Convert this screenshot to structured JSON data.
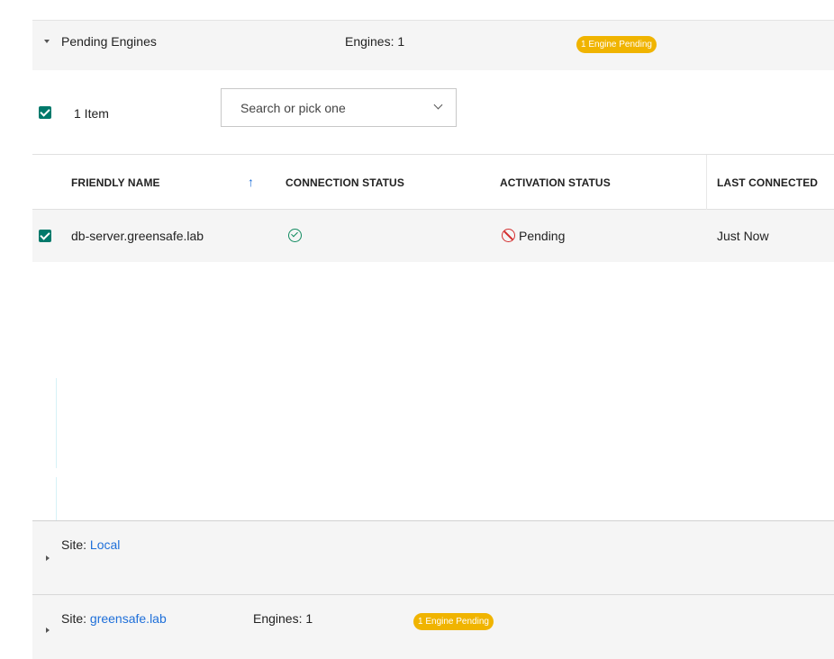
{
  "pending": {
    "title": "Pending Engines",
    "engines": "Engines: 1",
    "badge": "1 Engine Pending"
  },
  "toolbar": {
    "item_count": "1 Item",
    "search_placeholder": "Search or pick one"
  },
  "table": {
    "columns": {
      "friendly_name": "FRIENDLY NAME",
      "connection_status": "CONNECTION STATUS",
      "activation_status": "ACTIVATION STATUS",
      "last_connected": "LAST CONNECTED"
    },
    "sort_indicator": "↑",
    "rows": [
      {
        "friendly_name": "db-server.greensafe.lab",
        "connection_icon": "check-circle-icon",
        "activation_status": "Pending",
        "activation_icon": "blocked-icon",
        "last_connected": "Just Now"
      }
    ]
  },
  "sites": [
    {
      "label": "Site:",
      "name": "Local"
    },
    {
      "label": "Site:",
      "name": "greensafe.lab",
      "engines": "Engines: 1",
      "badge": "1 Engine Pending"
    }
  ],
  "colors": {
    "badge": "#f0b400",
    "checkbox": "#00796b",
    "link": "#1e6fd9",
    "connected": "#0f8a5f",
    "blocked": "#d32f2f"
  }
}
